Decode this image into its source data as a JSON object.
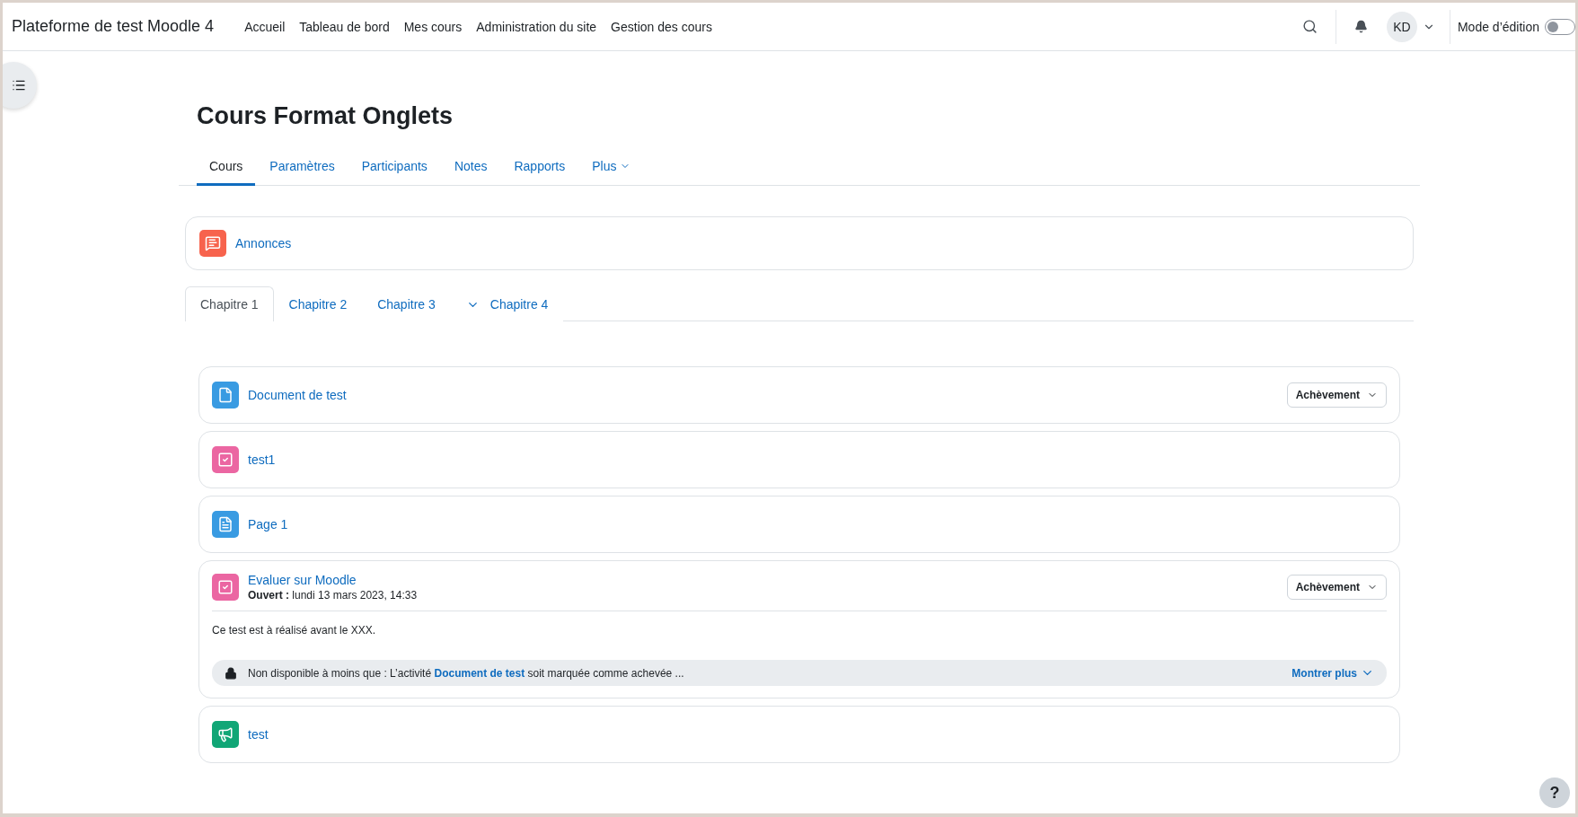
{
  "navbar": {
    "brand": "Plateforme de test Moodle 4",
    "links": [
      "Accueil",
      "Tableau de bord",
      "Mes cours",
      "Administration du site",
      "Gestion des cours"
    ],
    "user_initials": "KD",
    "edit_mode": {
      "label": "Mode d’édition",
      "on": false
    }
  },
  "course": {
    "title": "Cours Format Onglets",
    "tabs": [
      {
        "label": "Cours",
        "selected": true,
        "menu": false
      },
      {
        "label": "Paramètres",
        "selected": false,
        "menu": false
      },
      {
        "label": "Participants",
        "selected": false,
        "menu": false
      },
      {
        "label": "Notes",
        "selected": false,
        "menu": false
      },
      {
        "label": "Rapports",
        "selected": false,
        "menu": false
      },
      {
        "label": "Plus",
        "selected": false,
        "menu": true
      }
    ]
  },
  "top_activity": {
    "kind": "forum",
    "name": "Annonces"
  },
  "section_tabs": [
    {
      "label": "Chapitre 1",
      "selected": true,
      "kind": "plain"
    },
    {
      "label": "Chapitre 2",
      "selected": false,
      "kind": "plain"
    },
    {
      "label": "Chapitre 3",
      "selected": false,
      "kind": "plain"
    },
    {
      "label": "Chapitre 4",
      "selected": false,
      "kind": "collapsible"
    }
  ],
  "activities": [
    {
      "kind": "file",
      "name": "Document de test",
      "completion": "Achèvement"
    },
    {
      "kind": "quiz",
      "name": "test1"
    },
    {
      "kind": "page",
      "name": "Page 1"
    },
    {
      "kind": "quiz",
      "name": "Evaluer sur Moodle",
      "completion": "Achèvement",
      "dates": "**Ouvert :** lundi 13 mars 2023, 14:33",
      "description": "Ce test est à réalisé avant le XXX.",
      "restriction": {
        "before": "Non disponible à moins que : L’activité ",
        "link": "Document de test",
        "after": " soit marquée comme achevée ...",
        "more": "Montrer plus"
      }
    },
    {
      "kind": "feedback",
      "name": "test"
    }
  ],
  "help": "?"
}
